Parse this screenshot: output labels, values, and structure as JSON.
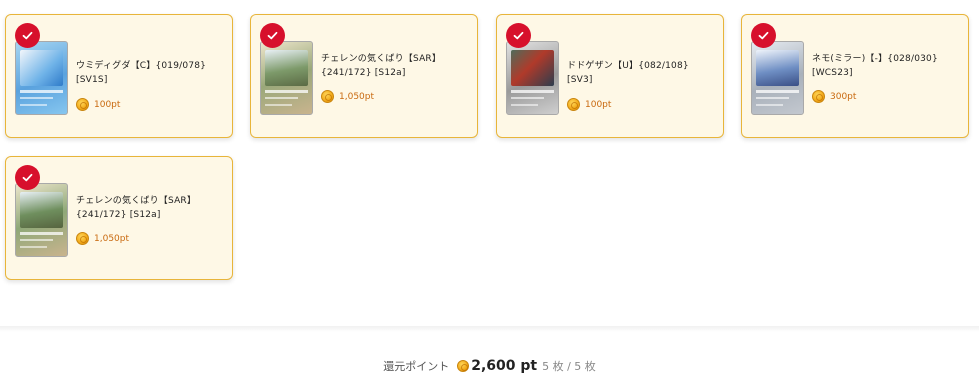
{
  "cards": [
    {
      "name": "ウミディグダ【C】{019/078} [SV1S]",
      "points": "100pt",
      "thumb_colors": [
        "#9fd0ef",
        "#3d8bd6",
        "#7fc2ee"
      ]
    },
    {
      "name": "チェレンの気くばり【SAR】{241/172} [S12a]",
      "points": "1,050pt",
      "thumb_colors": [
        "#e9e2c8",
        "#7a8c5a",
        "#c7b08a"
      ]
    },
    {
      "name": "ドドゲザン【U】{082/108} [SV3]",
      "points": "100pt",
      "thumb_colors": [
        "#d9d9d9",
        "#5a6f5a",
        "#a8a8a8"
      ]
    },
    {
      "name": "ネモ(ミラー)【-】{028/030} [WCS23]",
      "points": "300pt",
      "thumb_colors": [
        "#dfe6ef",
        "#5478b3",
        "#b9bfc7"
      ]
    },
    {
      "name": "チェレンの気くばり【SAR】{241/172} [S12a]",
      "points": "1,050pt",
      "thumb_colors": [
        "#e9e2c8",
        "#6a8c58",
        "#c7b08a"
      ]
    }
  ],
  "footer": {
    "label": "還元ポイント",
    "total": "2,600 pt",
    "count": "5 枚 / 5 枚"
  },
  "colors": {
    "card_bg": "#fef8e6",
    "card_border": "#e8b53a",
    "check_red": "#d7102c",
    "points_orange": "#c96a10"
  },
  "icons": {
    "check": "checkmark-icon",
    "coin": "coin-icon"
  }
}
